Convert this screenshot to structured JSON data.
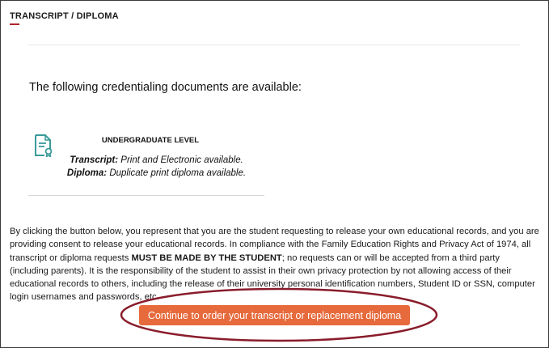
{
  "section": {
    "title": "TRANSCRIPT / DIPLOMA"
  },
  "intro_text": "The following credentialing documents are available:",
  "document": {
    "icon": "certificate-document-icon",
    "level": "UNDERGRADUATE LEVEL",
    "transcript_label": "Transcript:",
    "transcript_text": "Print and Electronic available.",
    "diploma_label": "Diploma:",
    "diploma_text": "Duplicate print diploma available."
  },
  "consent": {
    "part1": "By clicking the button below, you represent that you are the student requesting to release your own educational records, and you are providing consent to release your educational records. In compliance with the Family Education Rights and Privacy Act of 1974, all transcript or diploma requests ",
    "emphasis": "MUST BE MADE BY THE STUDENT",
    "part2": "; no requests can or will be accepted from a third party (including parents). It is the responsibility of the student to assist in their own privacy protection by not allowing access of their educational records to others, including the release of their university personal identification numbers, Student ID or SSN, computer login usernames and passwords, etc."
  },
  "continue_button": {
    "label": "Continue to order your transcript or replacement diploma"
  },
  "colors": {
    "accent_underline": "#b1252d",
    "button_bg": "#e66a3c",
    "highlight_ring": "#8a1c2b",
    "icon_teal": "#3a9a9a"
  }
}
